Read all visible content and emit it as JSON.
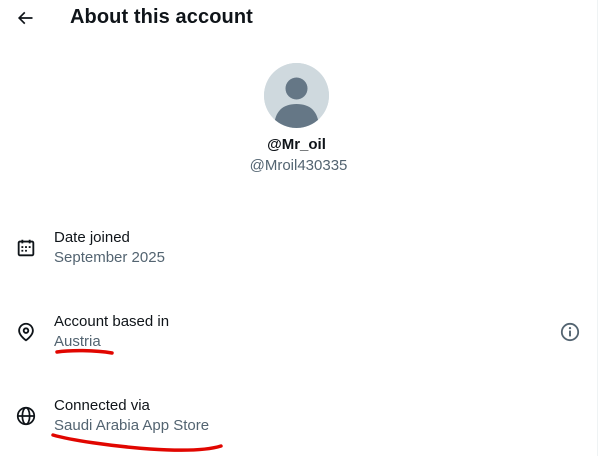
{
  "header": {
    "title": "About this account",
    "back_icon": "arrow-left-icon"
  },
  "profile": {
    "display_name": "@Mr_oil",
    "handle": "@Mroil430335",
    "avatar_icon": "default-avatar-icon"
  },
  "rows": [
    {
      "icon": "calendar-icon",
      "label": "Date joined",
      "value": "September 2025"
    },
    {
      "icon": "location-pin-icon",
      "label": "Account based in",
      "value": "Austria",
      "action_icon": "info-icon"
    },
    {
      "icon": "globe-icon",
      "label": "Connected via",
      "value": "Saudi Arabia App Store"
    }
  ],
  "colors": {
    "text_primary": "#0f1419",
    "text_secondary": "#536471",
    "avatar_bg": "#cfd9de",
    "avatar_fg": "#657786",
    "marker": "#e10600"
  }
}
